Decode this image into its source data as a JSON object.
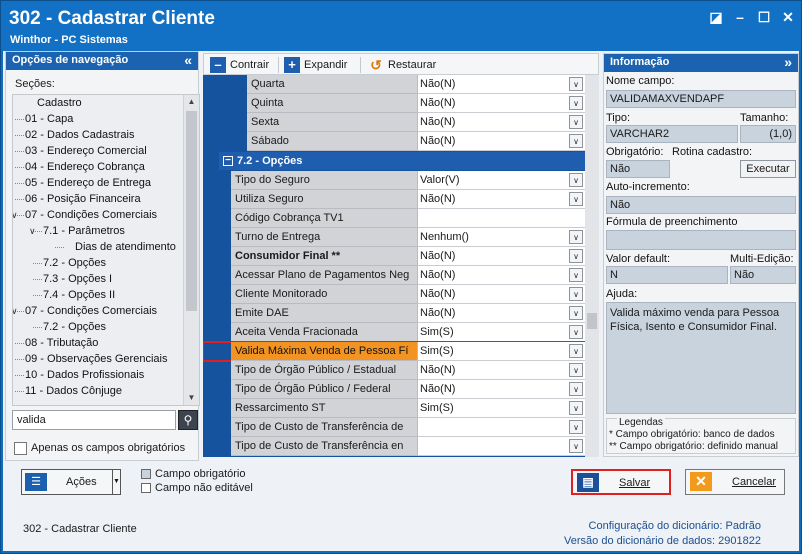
{
  "window": {
    "title": "302 - Cadastrar Cliente",
    "subtitle": "Winthor - PC Sistemas",
    "controls": [
      "◪",
      "–",
      "☐",
      "✕"
    ]
  },
  "nav_panel": {
    "header": "Opções de navegação",
    "collapse_glyph": "«",
    "sections_label": "Seções:",
    "items": [
      {
        "label": "Cadastro",
        "level": 0,
        "expanded": false
      },
      {
        "label": "01 - Capa",
        "level": 1
      },
      {
        "label": "02 - Dados Cadastrais",
        "level": 1
      },
      {
        "label": "03 - Endereço Comercial",
        "level": 1
      },
      {
        "label": "04 - Endereço Cobrança",
        "level": 1
      },
      {
        "label": "05 - Endereço de Entrega",
        "level": 1
      },
      {
        "label": "06 - Posição Financeira",
        "level": 1
      },
      {
        "label": "07 - Condições Comerciais",
        "level": 1,
        "chevron": "v"
      },
      {
        "label": "7.1 - Parâmetros",
        "level": 2,
        "chevron": "v"
      },
      {
        "label": "Dias de atendimento",
        "level": 3
      },
      {
        "label": "7.2 - Opções",
        "level": 2
      },
      {
        "label": "7.3 - Opções I",
        "level": 2
      },
      {
        "label": "7.4 - Opções II",
        "level": 2
      },
      {
        "label": "07 - Condições Comerciais",
        "level": 1,
        "chevron": "v"
      },
      {
        "label": "7.2 - Opções",
        "level": 2
      },
      {
        "label": "08 - Tributação",
        "level": 1
      },
      {
        "label": "09 - Observações Gerenciais",
        "level": 1
      },
      {
        "label": "10 - Dados Profissionais",
        "level": 1
      },
      {
        "label": "11 - Dados Cônjuge",
        "level": 1
      }
    ],
    "search_value": "valida",
    "only_required_label": "Apenas os campos obrigatórios"
  },
  "toolbar": {
    "collapse_label": "Contrair",
    "expand_label": "Expandir",
    "restore_label": "Restaurar"
  },
  "grid": {
    "rows_before": [
      {
        "name": "Quarta",
        "value": "Não(N)",
        "dropdown": true
      },
      {
        "name": "Quinta",
        "value": "Não(N)",
        "dropdown": true
      },
      {
        "name": "Sexta",
        "value": "Não(N)",
        "dropdown": true
      },
      {
        "name": "Sábado",
        "value": "Não(N)",
        "dropdown": true
      }
    ],
    "section_title": "7.2 - Opções",
    "rows": [
      {
        "name": "Tipo do Seguro",
        "value": "Valor(V)",
        "dropdown": true
      },
      {
        "name": "Utiliza Seguro",
        "value": "Não(N)",
        "dropdown": true
      },
      {
        "name": "Código Cobrança TV1",
        "value": "",
        "dropdown": false
      },
      {
        "name": "Turno de Entrega",
        "value": "Nenhum()",
        "dropdown": true
      },
      {
        "name": "Consumidor Final **",
        "value": "Não(N)",
        "dropdown": true,
        "bold": true
      },
      {
        "name": "Acessar Plano de Pagamentos Neg",
        "value": "Não(N)",
        "dropdown": true
      },
      {
        "name": "Cliente Monitorado",
        "value": "Não(N)",
        "dropdown": true
      },
      {
        "name": "Emite DAE",
        "value": "Não(N)",
        "dropdown": true
      },
      {
        "name": "Aceita Venda Fracionada",
        "value": "Sim(S)",
        "dropdown": true
      },
      {
        "name": "Valida Máxima Venda de Pessoa Fí",
        "value": "Sim(S)",
        "dropdown": true,
        "highlight": true
      },
      {
        "name": "Tipo de Órgão Público / Estadual",
        "value": "Não(N)",
        "dropdown": true
      },
      {
        "name": "Tipo de Órgão Público / Federal",
        "value": "Não(N)",
        "dropdown": true
      },
      {
        "name": "Ressarcimento ST",
        "value": "Sim(S)",
        "dropdown": true
      },
      {
        "name": "Tipo de Custo de Transferência de",
        "value": "",
        "dropdown": true
      },
      {
        "name": "Tipo de Custo de Transferência en",
        "value": "",
        "dropdown": true
      }
    ]
  },
  "info_panel": {
    "header": "Informação",
    "collapse_glyph": "»",
    "field_name_label": "Nome campo:",
    "field_name": "VALIDAMAXVENDAPF",
    "type_label": "Tipo:",
    "type_value": "VARCHAR2",
    "size_label": "Tamanho:",
    "size_value": "(1,0)",
    "required_label": "Obrigatório:",
    "required_value": "Não",
    "routine_label": "Rotina cadastro:",
    "execute_label": "Executar",
    "autoinc_label": "Auto-incremento:",
    "autoinc_value": "Não",
    "formula_label": "Fórmula de preenchimento",
    "formula_value": "",
    "default_label": "Valor default:",
    "default_value": "N",
    "multiedit_label": "Multi-Edição:",
    "multiedit_value": "Não",
    "help_label": "Ajuda:",
    "help_text": "Valida máximo venda para Pessoa Física, Isento e Consumidor Final.",
    "legend_title": "Legendas",
    "legend_line1": "* Campo obrigatório: banco de dados",
    "legend_line2": "** Campo obrigatório: definido manual"
  },
  "bottom": {
    "actions_label": "Ações",
    "legend_required": "Campo obrigatório",
    "legend_readonly": "Campo não editável",
    "save_label": "Salvar",
    "cancel_label": "Cancelar",
    "footer_left": "302 - Cadastrar Cliente",
    "dict_config_label": "Configuração do dicionário:",
    "dict_config_value": "Padrão",
    "dict_version_label": "Versão do dicionário de dados:",
    "dict_version_value": "2901822"
  },
  "colors": {
    "title_bar": "#1271c4",
    "panel_header": "#1b63b0",
    "grid_bg": "#16539f",
    "highlight": "#f39321",
    "highlight_border": "#e02020"
  }
}
